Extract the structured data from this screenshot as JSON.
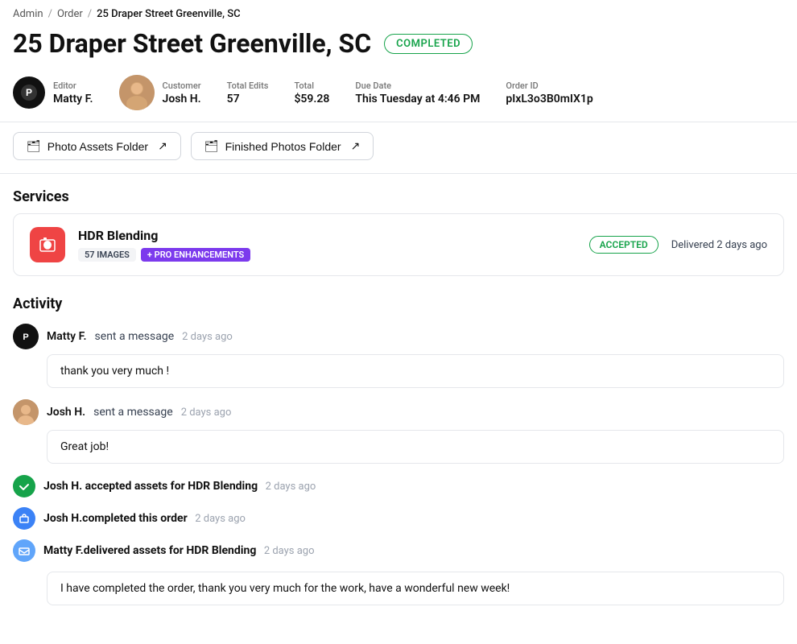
{
  "breadcrumb": {
    "items": [
      "Admin",
      "Order",
      "25 Draper Street  Greenville, SC"
    ],
    "sep": "/"
  },
  "page": {
    "title": "25 Draper Street  Greenville, SC",
    "status": "COMPLETED"
  },
  "meta": {
    "editor_label": "Editor",
    "editor_name": "Matty F.",
    "customer_label": "Customer",
    "customer_name": "Josh H.",
    "total_edits_label": "Total Edits",
    "total_edits_value": "57",
    "total_label": "Total",
    "total_value": "$59.28",
    "due_date_label": "Due Date",
    "due_date_value": "This Tuesday at 4:46 PM",
    "order_id_label": "Order ID",
    "order_id_value": "pIxL3o3B0mIX1p"
  },
  "folders": {
    "photo_assets": "Photo Assets Folder",
    "finished_photos": "Finished Photos Folder"
  },
  "services": {
    "section_title": "Services",
    "card": {
      "name": "HDR Blending",
      "tag_images": "57 IMAGES",
      "tag_pro": "+ PRO ENHANCEMENTS",
      "status": "ACCEPTED",
      "delivery": "Delivered 2 days ago"
    }
  },
  "activity": {
    "section_title": "Activity",
    "items": [
      {
        "type": "message",
        "sender": "Matty F.",
        "action": " sent a message",
        "time": "2 days ago",
        "message": "thank you very much !",
        "avatar_type": "editor"
      },
      {
        "type": "message",
        "sender": "Josh H.",
        "action": "sent a message",
        "time": "2 days ago",
        "message": "Great job!",
        "avatar_type": "customer"
      }
    ],
    "events": [
      {
        "type": "accepted",
        "text": "Josh H. accepted assets for HDR Blending",
        "time": "2 days ago",
        "icon": "check"
      },
      {
        "type": "completed",
        "text": "Josh H.completed this order",
        "time": "2 days ago",
        "icon": "complete"
      },
      {
        "type": "delivered",
        "text": "Matty F.delivered assets for HDR Blending",
        "time": "2 days ago",
        "icon": "deliver",
        "message": "I have completed the order, thank you very much for the work, have a wonderful new week!"
      }
    ]
  }
}
